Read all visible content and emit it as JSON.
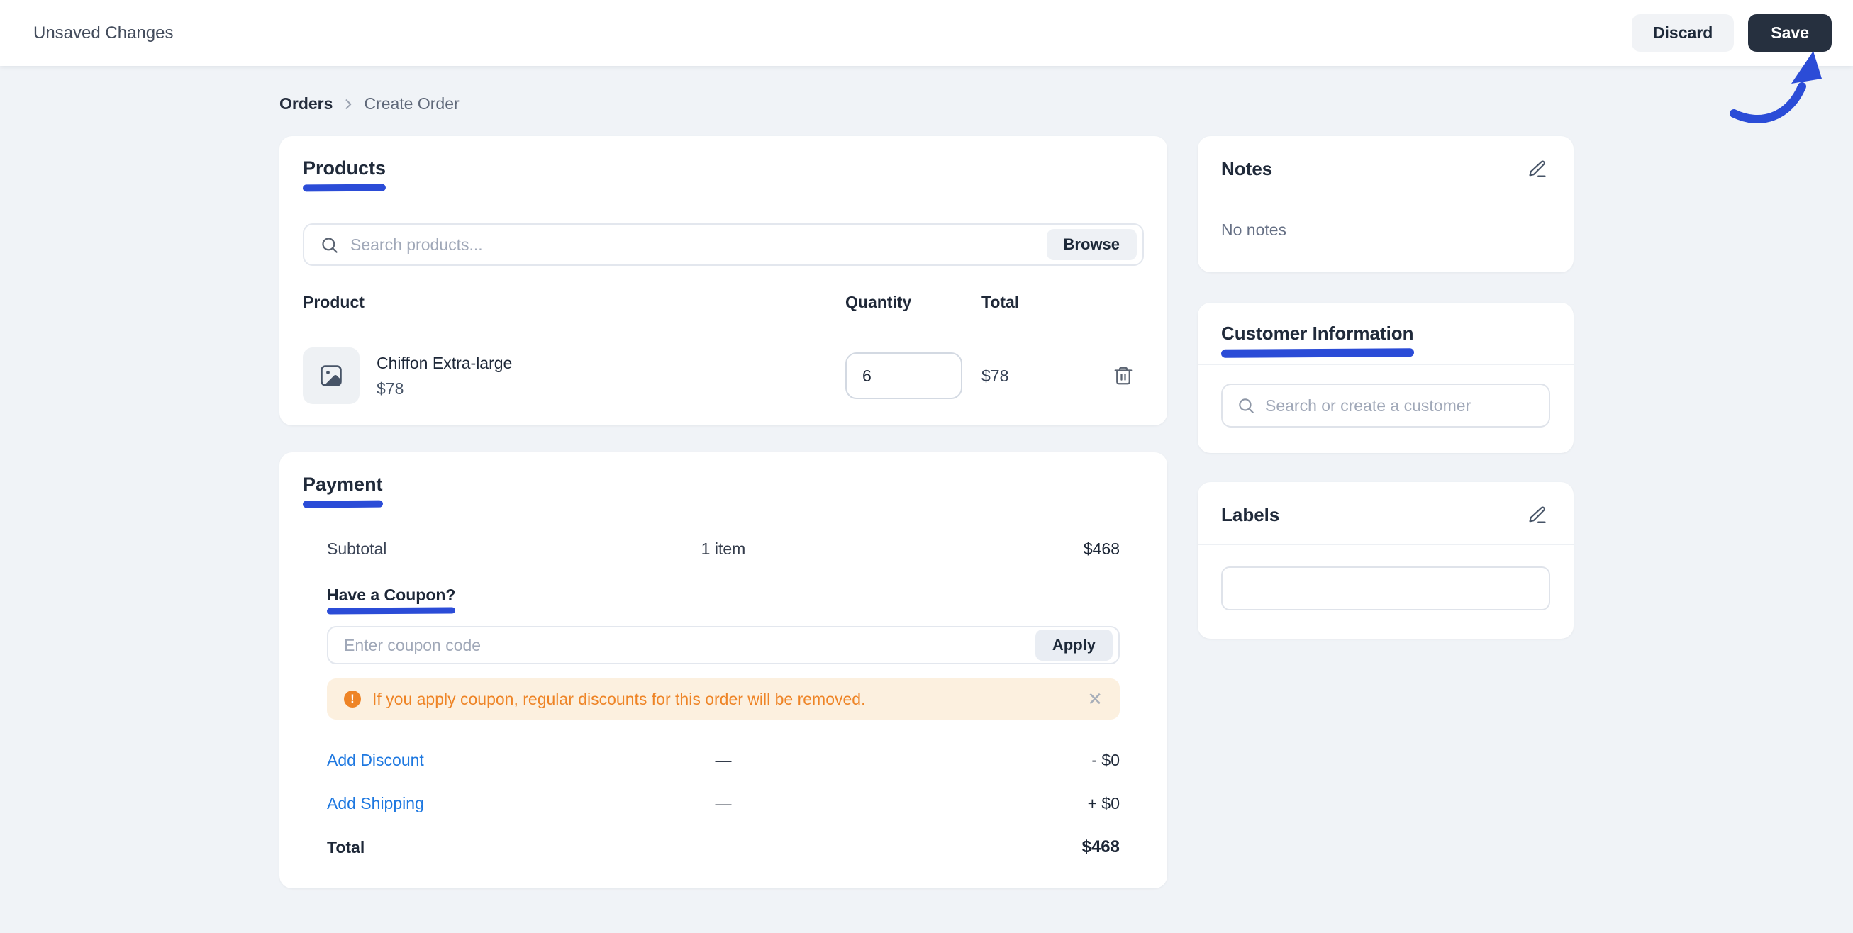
{
  "colors": {
    "annotation_blue": "#2b4cd7",
    "link_blue": "#1e78e0",
    "warning_orange": "#ee8426",
    "warning_bg": "#fcf0df",
    "save_button_bg": "#26303f",
    "page_bg": "#f0f3f7"
  },
  "topbar": {
    "status": "Unsaved Changes",
    "discard": "Discard",
    "save": "Save"
  },
  "breadcrumb": {
    "root": "Orders",
    "current": "Create Order"
  },
  "products": {
    "title": "Products",
    "search_placeholder": "Search products...",
    "browse": "Browse",
    "col_product": "Product",
    "col_quantity": "Quantity",
    "col_total": "Total",
    "rows": [
      {
        "name": "Chiffon Extra-large",
        "price": "$78",
        "quantity": "6",
        "total": "$78"
      }
    ]
  },
  "payment": {
    "title": "Payment",
    "subtotal_label": "Subtotal",
    "subtotal_items": "1 item",
    "subtotal_value": "$468",
    "coupon_label": "Have a Coupon?",
    "coupon_placeholder": "Enter coupon code",
    "apply": "Apply",
    "warning_glyph": "!",
    "warning_text": "If you apply coupon, regular discounts for this order will be removed.",
    "close_glyph": "✕",
    "rows": [
      {
        "label": "Add Discount",
        "dash": "—",
        "value": "- $0"
      },
      {
        "label": "Add Shipping",
        "dash": "—",
        "value": "+ $0"
      }
    ],
    "total_label": "Total",
    "total_value": "$468"
  },
  "notes": {
    "title": "Notes",
    "empty": "No notes"
  },
  "customer": {
    "title": "Customer Information",
    "search_placeholder": "Search or create a customer"
  },
  "labels": {
    "title": "Labels"
  }
}
